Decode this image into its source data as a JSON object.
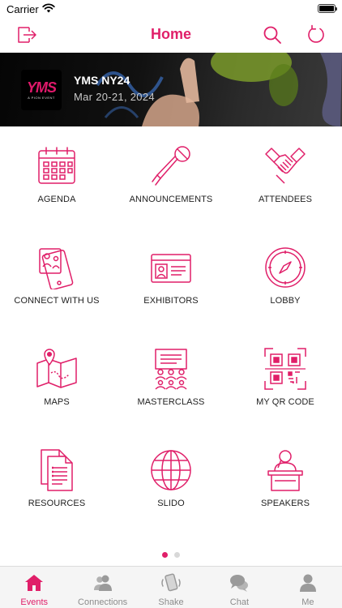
{
  "status_bar": {
    "carrier": "Carrier"
  },
  "nav": {
    "title": "Home",
    "left_icon": "logout-icon",
    "right_icons": [
      "search-icon",
      "refresh-icon"
    ]
  },
  "banner": {
    "logo_text": "YMS",
    "logo_subtext": "A PION EVENT",
    "event_name": "YMS NY24",
    "event_dates": "Mar 20-21, 2024"
  },
  "tiles": [
    {
      "label": "AGENDA",
      "icon": "calendar-icon"
    },
    {
      "label": "ANNOUNCEMENTS",
      "icon": "microphone-icon"
    },
    {
      "label": "ATTENDEES",
      "icon": "handshake-icon"
    },
    {
      "label": "CONNECT WITH US",
      "icon": "phone-social-icon"
    },
    {
      "label": "EXHIBITORS",
      "icon": "id-card-icon"
    },
    {
      "label": "LOBBY",
      "icon": "compass-icon"
    },
    {
      "label": "MAPS",
      "icon": "map-pin-icon"
    },
    {
      "label": "MASTERCLASS",
      "icon": "classroom-icon"
    },
    {
      "label": "MY QR CODE",
      "icon": "qr-code-icon"
    },
    {
      "label": "RESOURCES",
      "icon": "documents-icon"
    },
    {
      "label": "SLIDO",
      "icon": "globe-icon"
    },
    {
      "label": "SPEAKERS",
      "icon": "speaker-podium-icon"
    }
  ],
  "pager": {
    "pages": 2,
    "current": 1
  },
  "tabs": [
    {
      "label": "Events",
      "icon": "home-icon",
      "active": true
    },
    {
      "label": "Connections",
      "icon": "people-icon",
      "active": false
    },
    {
      "label": "Shake",
      "icon": "shake-phone-icon",
      "active": false
    },
    {
      "label": "Chat",
      "icon": "chat-bubbles-icon",
      "active": false
    },
    {
      "label": "Me",
      "icon": "person-icon",
      "active": false
    }
  ],
  "colors": {
    "accent": "#e01f69",
    "tab_inactive": "#8c8c8c",
    "tab_bar_bg": "#f5f5f5"
  }
}
